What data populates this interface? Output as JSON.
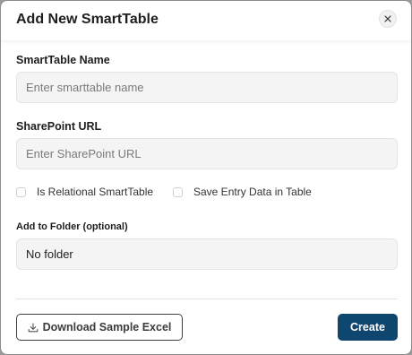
{
  "dialog": {
    "title": "Add New SmartTable",
    "close_icon": "close-icon"
  },
  "form": {
    "name": {
      "label": "SmartTable Name",
      "placeholder": "Enter smarttable name",
      "value": ""
    },
    "url": {
      "label": "SharePoint URL",
      "placeholder": "Enter SharePoint URL",
      "value": ""
    },
    "relational": {
      "label": "Is Relational SmartTable",
      "checked": false
    },
    "save_entry": {
      "label": "Save Entry Data in Table",
      "checked": false
    },
    "folder": {
      "label": "Add to Folder (optional)",
      "selected": "No folder"
    }
  },
  "footer": {
    "download_label": "Download Sample Excel",
    "download_icon": "download-icon",
    "create_label": "Create"
  },
  "colors": {
    "primary": "#0f4670",
    "field_bg": "#f4f4f4"
  }
}
